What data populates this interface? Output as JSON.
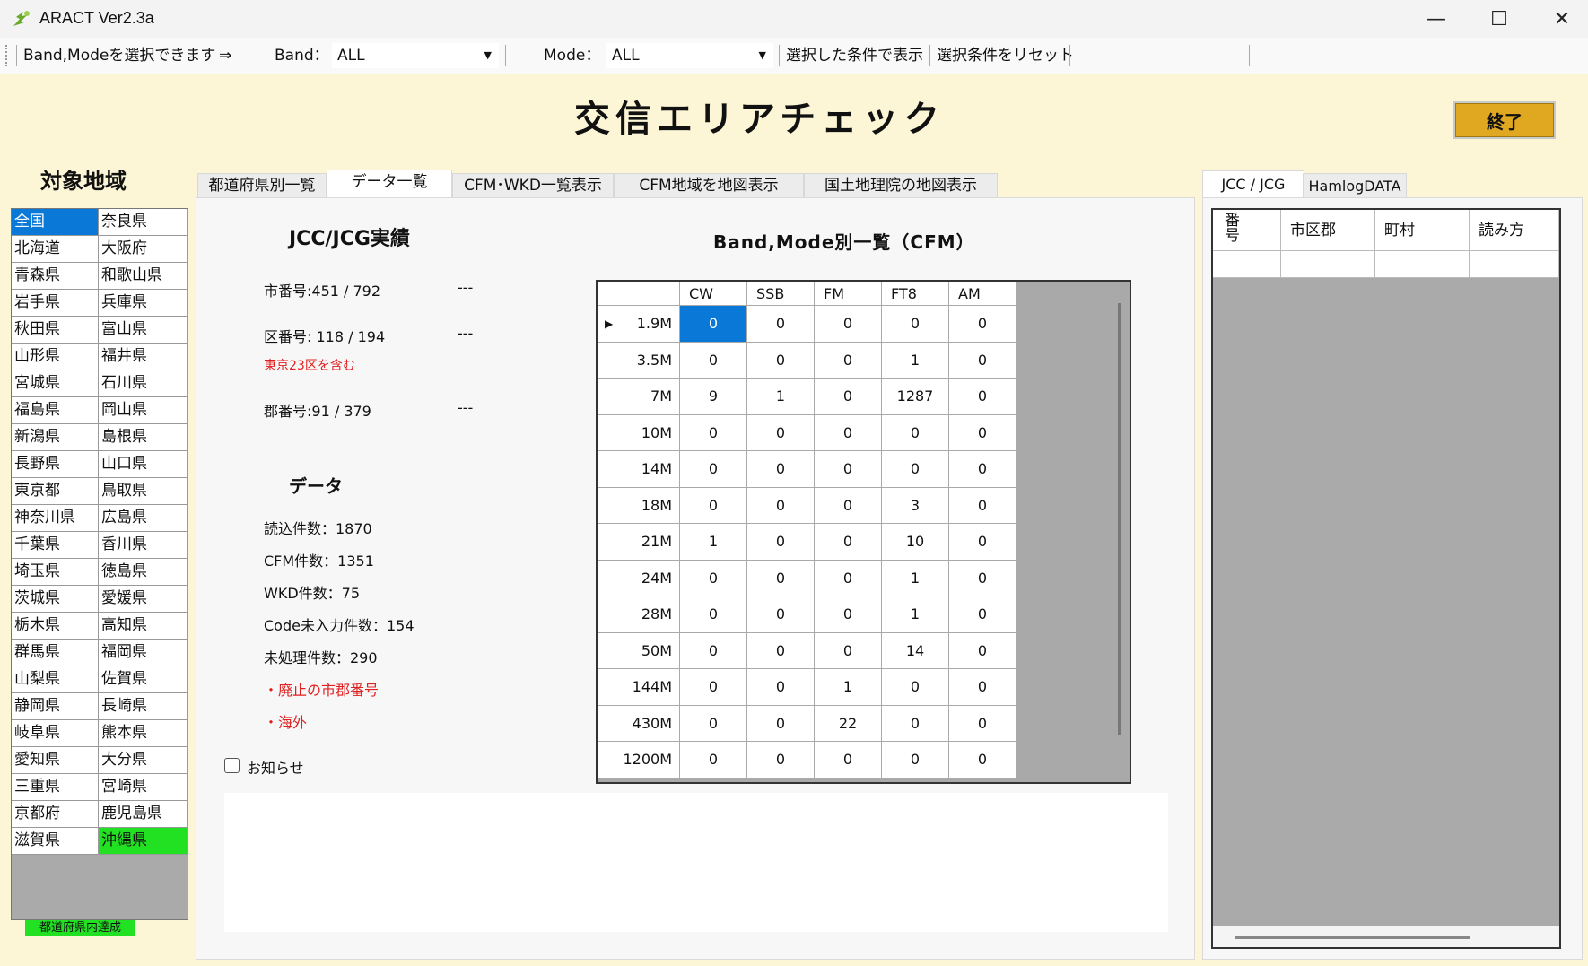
{
  "window": {
    "title": "ARACT Ver2.3a",
    "minimize": "—",
    "maximize": "☐",
    "close": "✕"
  },
  "toolbar": {
    "hint": "Band,Modeを選択できます",
    "arrow": "⇒",
    "band_label": "Band：",
    "band_value": "ALL",
    "mode_label": "Mode：",
    "mode_value": "ALL",
    "show_button": "選択した条件で表示",
    "reset_button": "選択条件をリセット"
  },
  "main_title": "交信エリアチェック",
  "exit_button": "終了",
  "region": {
    "title": "対象地域",
    "left": [
      "全国",
      "北海道",
      "青森県",
      "岩手県",
      "秋田県",
      "山形県",
      "宮城県",
      "福島県",
      "新潟県",
      "長野県",
      "東京都",
      "神奈川県",
      "千葉県",
      "埼玉県",
      "茨城県",
      "栃木県",
      "群馬県",
      "山梨県",
      "静岡県",
      "岐阜県",
      "愛知県",
      "三重県",
      "京都府",
      "滋賀県"
    ],
    "right": [
      "奈良県",
      "大阪府",
      "和歌山県",
      "兵庫県",
      "富山県",
      "福井県",
      "石川県",
      "岡山県",
      "島根県",
      "山口県",
      "鳥取県",
      "広島県",
      "香川県",
      "徳島県",
      "愛媛県",
      "高知県",
      "福岡県",
      "佐賀県",
      "長崎県",
      "熊本県",
      "大分県",
      "宮崎県",
      "鹿児島県",
      "沖縄県"
    ],
    "selected": "全国",
    "achieved": "沖縄県",
    "legend": "都道府県内達成",
    "selected_color": "#0a78d7",
    "achieved_color": "#22e022"
  },
  "tabs": [
    "都道府県別一覧",
    "データ一覧",
    "CFM･WKD一覧表示",
    "CFM地域を地図表示",
    "国土地理院の地図表示"
  ],
  "active_tab": "データ一覧",
  "jcc": {
    "title": "JCC/JCG実績",
    "city": "市番号:451 / 792",
    "city_dash": "---",
    "ku": "区番号: 118 / 194",
    "ku_dash": "---",
    "ku_note": "東京23区を含む",
    "gun": "郡番号:91 / 379",
    "gun_dash": "---"
  },
  "data": {
    "title": "データ",
    "read": "読込件数：1870",
    "cfm": "CFM件数：1351",
    "wkd": "WKD件数：75",
    "code_missing": "Code未入力件数：154",
    "unprocessed": "未処理件数：290",
    "abolished": "・廃止の市郡番号",
    "overseas": "・海外",
    "notice_label": "お知らせ"
  },
  "table": {
    "title": "Band,Mode別一覧（CFM）",
    "columns": [
      "CW",
      "SSB",
      "FM",
      "FT8",
      "AM"
    ],
    "rows": [
      {
        "band": "1.9M",
        "values": [
          "0",
          "0",
          "0",
          "0",
          "0"
        ]
      },
      {
        "band": "3.5M",
        "values": [
          "0",
          "0",
          "0",
          "1",
          "0"
        ]
      },
      {
        "band": "7M",
        "values": [
          "9",
          "1",
          "0",
          "1287",
          "0"
        ]
      },
      {
        "band": "10M",
        "values": [
          "0",
          "0",
          "0",
          "0",
          "0"
        ]
      },
      {
        "band": "14M",
        "values": [
          "0",
          "0",
          "0",
          "0",
          "0"
        ]
      },
      {
        "band": "18M",
        "values": [
          "0",
          "0",
          "0",
          "3",
          "0"
        ]
      },
      {
        "band": "21M",
        "values": [
          "1",
          "0",
          "0",
          "10",
          "0"
        ]
      },
      {
        "band": "24M",
        "values": [
          "0",
          "0",
          "0",
          "1",
          "0"
        ]
      },
      {
        "band": "28M",
        "values": [
          "0",
          "0",
          "0",
          "1",
          "0"
        ]
      },
      {
        "band": "50M",
        "values": [
          "0",
          "0",
          "0",
          "14",
          "0"
        ]
      },
      {
        "band": "144M",
        "values": [
          "0",
          "0",
          "1",
          "0",
          "0"
        ]
      },
      {
        "band": "430M",
        "values": [
          "0",
          "0",
          "22",
          "0",
          "0"
        ]
      },
      {
        "band": "1200M",
        "values": [
          "0",
          "0",
          "0",
          "0",
          "0"
        ]
      }
    ],
    "current_row_marker": "▶"
  },
  "right": {
    "tab_jcc": "JCC / JCG",
    "tab_hamlog": "HamlogDATA",
    "columns": [
      "番号",
      "市区郡",
      "町村",
      "読み方"
    ]
  }
}
